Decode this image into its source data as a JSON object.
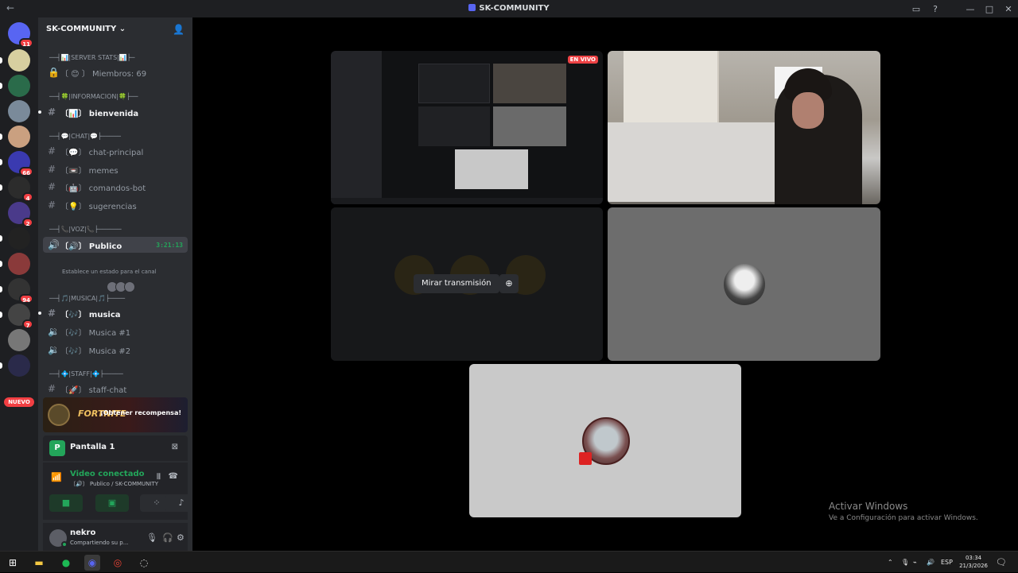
{
  "window": {
    "title": "SK-COMMUNITY",
    "back_icon": "←"
  },
  "guilds": {
    "items": [
      {
        "badge": "11"
      },
      {
        "badge": ""
      },
      {
        "badge": ""
      },
      {
        "badge": ""
      },
      {
        "badge": ""
      },
      {
        "badge": "66"
      },
      {
        "badge": "4"
      },
      {
        "badge": "2"
      },
      {
        "badge": ""
      },
      {
        "badge": ""
      },
      {
        "badge": "94"
      },
      {
        "badge": "7"
      },
      {
        "badge": ""
      },
      {
        "badge": ""
      }
    ],
    "nuevo_label": "NUEVO"
  },
  "server": {
    "name": "SK-COMMUNITY",
    "chevron": "⌄"
  },
  "channels": {
    "cat_server_stats": "──┤📊|SERVER STATS|📊├─",
    "miembros": "〔 😊 〕 Miembros: 69",
    "cat_informacion": "──┤🍀|INFORMACION|🍀├──",
    "bienvenida": "〔📊〕 bienvenida",
    "cat_chat": "──┤💬|CHAT|💬├─────",
    "chat_principal": "〔💬〕 chat-principal",
    "memes": "〔📼〕 memes",
    "comandos_bot": "〔🤖〕 comandos-bot",
    "sugerencias": "〔💡〕 sugerencias",
    "cat_voz": "──┤📞|VOZ|📞├──────",
    "publico": "〔🔊〕 Publico",
    "publico_time": "3:21:13",
    "publico_status": "Establece un estado para el canal",
    "cat_musica": "──┤🎵|MUSICA|🎵├────",
    "musica": "〔🎶〕 musica",
    "musica1": "〔🎶〕 Musica #1",
    "musica2": "〔🎶〕 Musica #2",
    "cat_staff": "──┤💠|STAFF|💠├─────",
    "staff_chat": "〔🚀〕 staff-chat"
  },
  "promo": {
    "brand": "FORTNITE",
    "cta": "¡Obtener recompensa!"
  },
  "screen_share": {
    "app_letter": "P",
    "name": "Pantalla 1"
  },
  "voice": {
    "status": "Video conectado",
    "sub": "〔🔊〕 Publico / SK-COMMUNITY"
  },
  "user": {
    "name": "nekro",
    "status": "Compartiendo su p..."
  },
  "stage": {
    "live_badge": "EN VIVO",
    "watch_label": "Mirar transmisión"
  },
  "activation": {
    "title": "Activar Windows",
    "subtitle": "Ve a Configuración para activar Windows."
  },
  "taskbar": {
    "lang": "ESP",
    "time": "03:34",
    "date": "21/3/2026"
  },
  "colors": {
    "green": "#23a55a",
    "red": "#f23f43",
    "sidebar": "#2b2d31"
  }
}
